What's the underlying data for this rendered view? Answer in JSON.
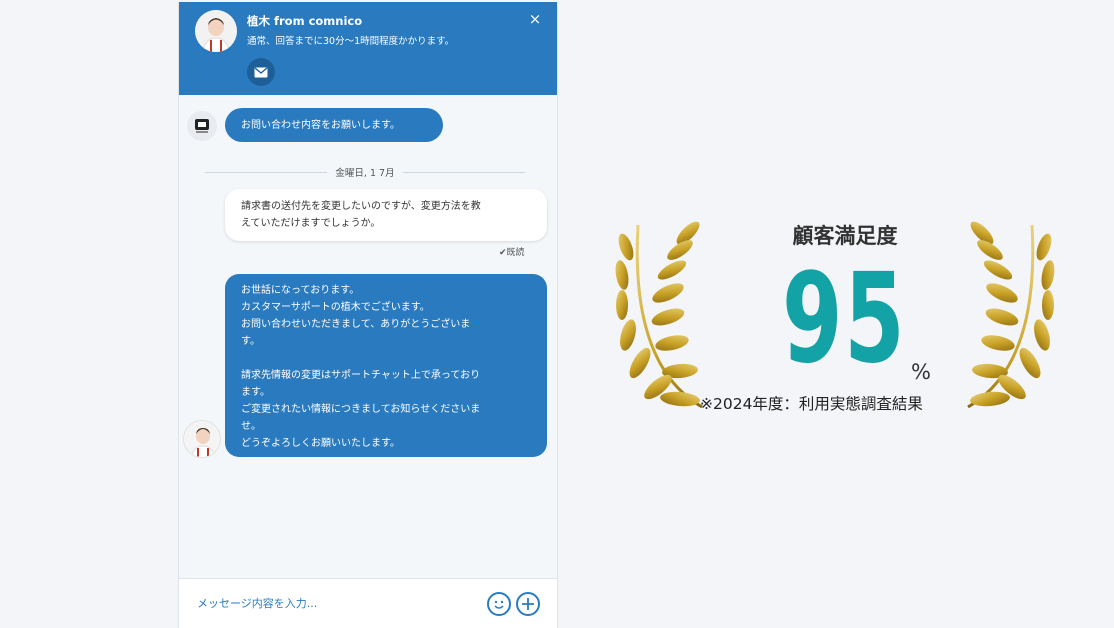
{
  "chat": {
    "agent_name": "植木 from comnico",
    "status": "通常、回答までに30分〜1時間程度かかります。",
    "close_label": "×",
    "bot_message": "お問い合わせ内容をお願いします。",
    "date_label": "金曜日, 1 7月",
    "user_message_lines": [
      "請求書の送付先を変更したいのですが、変更方法を教",
      "えていただけますでしょうか。"
    ],
    "read_label": "✔既読",
    "agent_reply_lines": [
      "お世話になっております。",
      "カスタマーサポートの植木でございます。",
      "お問い合わせいただきまして、ありがとうございま",
      "す。",
      "",
      "請求先情報の変更はサポートチャット上で承っており",
      "ます。",
      "ご変更されたい情報につきましてお知らせくださいま",
      "せ。",
      "どうぞよろしくお願いいたします。"
    ],
    "input_placeholder": "メッセージ内容を入力...",
    "icons": {
      "mail": "mail-icon",
      "emoji": "emoji-icon",
      "add": "plus-icon"
    },
    "colors": {
      "primary": "#2a7ac0",
      "header_dark": "#1e5f9a"
    }
  },
  "badge": {
    "title": "顧客満足度",
    "value": "95",
    "unit": "%",
    "note": "※2024年度：利用実態調査結果",
    "colors": {
      "value": "#13a3a6",
      "laurel": "#c9a227"
    }
  }
}
